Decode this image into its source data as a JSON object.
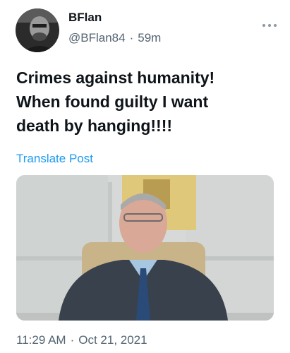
{
  "author": {
    "display_name": "BFlan",
    "handle": "@BFlan84",
    "time_ago": "59m",
    "separator": "·"
  },
  "tweet": {
    "lines": [
      "Crimes against humanity!",
      "When found guilty I want",
      "death by hanging!!!!"
    ],
    "translate_label": "Translate Post"
  },
  "footer": {
    "time": "11:29 AM",
    "separator": "·",
    "date": "Oct 21, 2021"
  },
  "icons": {
    "more": "more-horizontal-icon"
  },
  "colors": {
    "text": "#0f1419",
    "secondary": "#536471",
    "link": "#1d9bf0"
  }
}
